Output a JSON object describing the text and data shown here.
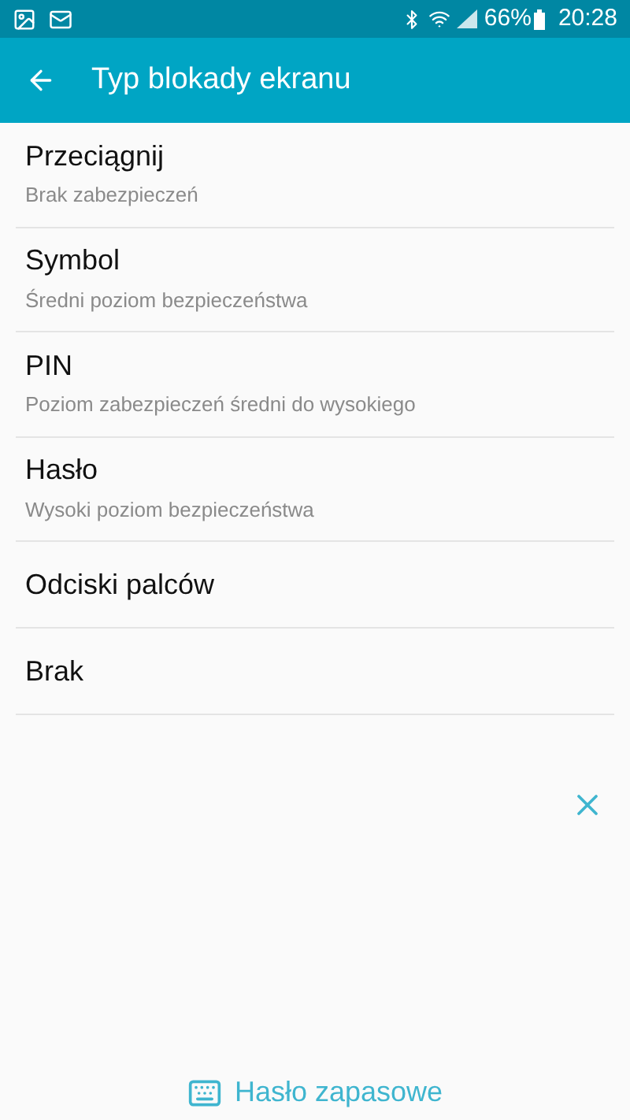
{
  "status_bar": {
    "battery": "66%",
    "time": "20:28"
  },
  "header": {
    "title": "Typ blokady ekranu"
  },
  "options": [
    {
      "title": "Przeciągnij",
      "subtitle": "Brak zabezpieczeń"
    },
    {
      "title": "Symbol",
      "subtitle": "Średni poziom bezpieczeństwa"
    },
    {
      "title": "PIN",
      "subtitle": "Poziom zabezpieczeń średni do wysokiego"
    },
    {
      "title": "Hasło",
      "subtitle": "Wysoki poziom bezpieczeństwa"
    },
    {
      "title": "Odciski palców"
    },
    {
      "title": "Brak"
    }
  ],
  "backup_link": "Hasło zapasowe"
}
